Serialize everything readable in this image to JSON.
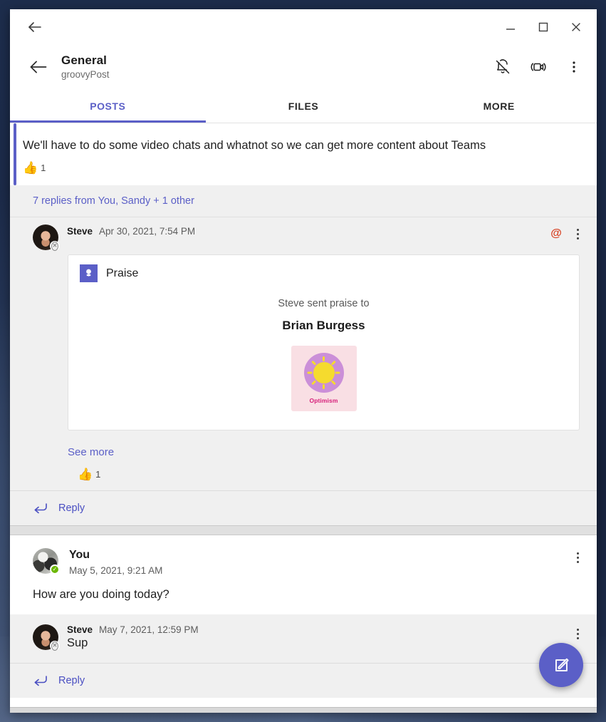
{
  "window": {
    "back_label": "Back",
    "minimize_label": "Minimize",
    "maximize_label": "Maximize",
    "close_label": "Close"
  },
  "header": {
    "back_label": "Back",
    "channel_name": "General",
    "team_name": "groovyPost",
    "actions": [
      {
        "name": "mute-notifications-icon",
        "label": "Notifications off"
      },
      {
        "name": "meet-now-icon",
        "label": "Meet now"
      },
      {
        "name": "more-options-icon",
        "label": "More options"
      }
    ]
  },
  "tabs": [
    {
      "label": "POSTS",
      "active": true
    },
    {
      "label": "FILES",
      "active": false
    },
    {
      "label": "MORE",
      "active": false
    }
  ],
  "posts": [
    {
      "text": "We'll have to do some video chats and whatnot so we can get more content about Teams",
      "reaction": {
        "emoji": "👍",
        "count": "1"
      },
      "replies_summary": "7 replies from You, Sandy + 1 other"
    }
  ],
  "praise_post": {
    "author": "Steve",
    "timestamp": "Apr 30, 2021, 7:54 PM",
    "presence": "offline",
    "mention_icon": "@",
    "card": {
      "app_title": "Praise",
      "sent_line": "Steve sent praise to",
      "recipient": "Brian Burgess",
      "badge_label": "Optimism"
    },
    "see_more": "See more",
    "reaction": {
      "emoji": "👍",
      "count": "1"
    },
    "reply_label": "Reply"
  },
  "second_post": {
    "author": "You",
    "timestamp": "May 5, 2021, 9:21 AM",
    "presence": "available",
    "text": "How are you doing today?",
    "reply": {
      "author": "Steve",
      "timestamp": "May 7, 2021, 12:59 PM",
      "text": "Sup",
      "presence": "offline"
    },
    "reply_label": "Reply"
  },
  "fab": {
    "label": "New conversation",
    "icon": "compose-icon"
  },
  "colors": {
    "accent_purple": "#5b5fc7",
    "accent_red": "#d74123",
    "available_green": "#6bb700",
    "badge_pink_bg": "#f9dfe4",
    "badge_circle": "#cb8fd8",
    "badge_sun": "#f5db2e",
    "badge_label": "#d61f7a"
  }
}
